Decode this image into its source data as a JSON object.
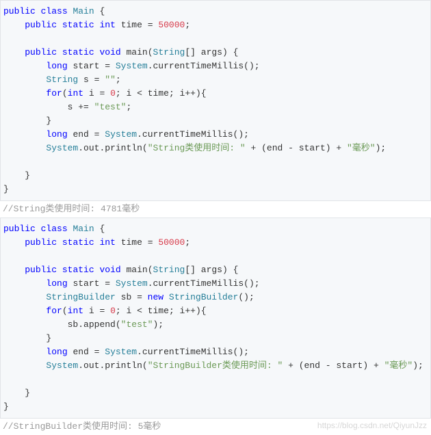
{
  "kw": {
    "public": "public",
    "class": "class",
    "static": "static",
    "int": "int",
    "void": "void",
    "long": "long",
    "for": "for",
    "new": "new"
  },
  "typ": {
    "Main": "Main",
    "String": "String",
    "System": "System",
    "StringBuilder": "StringBuilder"
  },
  "id": {
    "time": "time",
    "main": "main",
    "args": "args",
    "start": "start",
    "end": "end",
    "currentTimeMillis": "currentTimeMillis",
    "s": "s",
    "i": "i",
    "out": "out",
    "println": "println",
    "sb": "sb",
    "append": "append"
  },
  "num": {
    "n50000": "50000",
    "n0": "0"
  },
  "str": {
    "empty": "\"\"",
    "test": "\"test\"",
    "stringLabel": "\"String类使用时间: \"",
    "sbLabel": "\"StringBuilder类使用时间: \"",
    "ms": "\"毫秒\""
  },
  "punct": {
    "obrace": "{",
    "cbrace": "}",
    "eq": " = ",
    "semi": ";",
    "lparen": "(",
    "rparen": ")",
    "lbrack": "[",
    "rbrack": "]",
    "dot": ".",
    "lt": " < ",
    "inc": "++",
    "pluseq": " += ",
    "plus": " + ",
    "minus": " - ",
    "semisp": "; "
  },
  "comments": {
    "c1": "//String类使用时间: 4781毫秒",
    "c2": "//StringBuilder类使用时间: 5毫秒"
  },
  "watermark": "https://blog.csdn.net/QiyunJzz"
}
